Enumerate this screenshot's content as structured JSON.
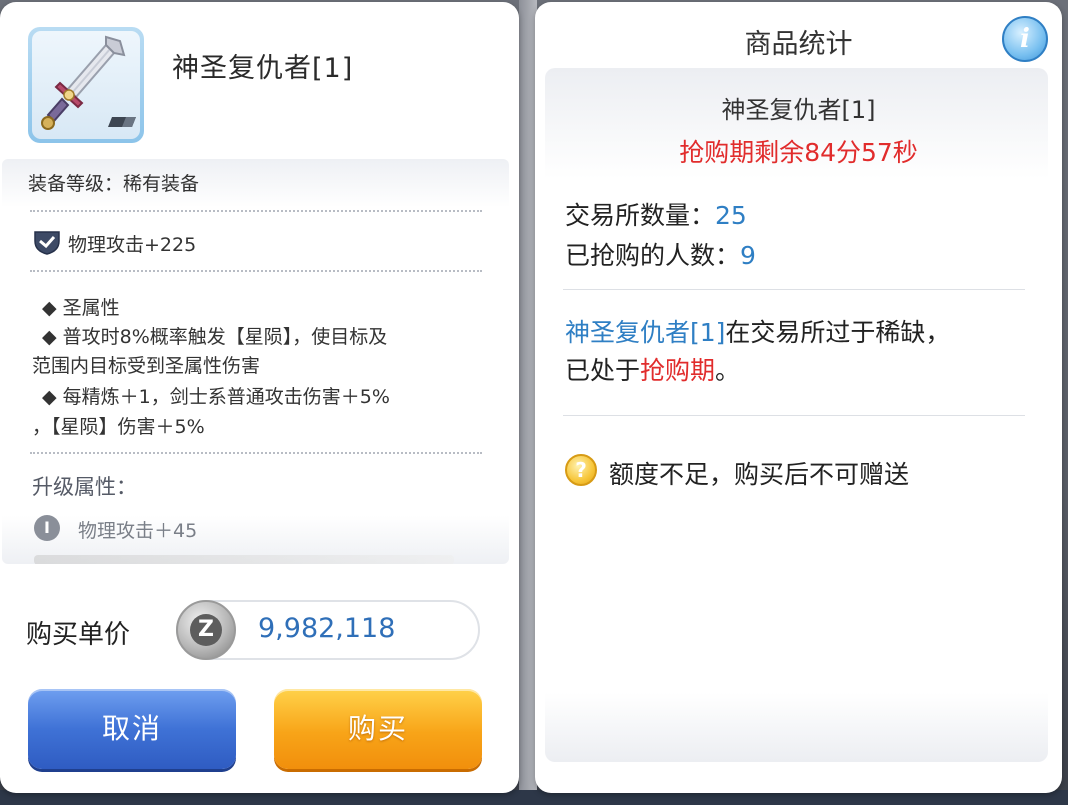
{
  "item": {
    "name": "神圣复仇者[1]"
  },
  "details": {
    "grade": "装备等级：稀有装备",
    "attack": "物理攻击+225",
    "effects": [
      "◆  圣属性",
      "◆  普攻时8%概率触发【星陨】，使目标及",
      "范围内目标受到圣属性伤害",
      "◆  每精炼＋1，剑士系普通攻击伤害＋5%",
      "，【星陨】伤害＋5%"
    ],
    "upgrade_title": "升级属性：",
    "upgrade_icon": "I",
    "upgrade_line": "物理攻击＋45"
  },
  "purchase": {
    "price_label": "购买单价",
    "currency_icon": "Z",
    "price": "9,982,118",
    "cancel_label": "取消",
    "buy_label": "购买"
  },
  "stats": {
    "title": "商品统计",
    "info_icon": "i",
    "item_name": "神圣复仇者[1]",
    "timer": "抢购期剩余84分57秒",
    "exchange_label": "交易所数量：",
    "exchange_count": "25",
    "bought_label": "已抢购的人数：",
    "bought_count": "9",
    "scarce_item": "神圣复仇者[1]",
    "scarce_mid": "在交易所过于稀缺，",
    "scarce_prefix": "已处于",
    "scarce_period": "抢购期",
    "scarce_end": "。",
    "question_icon": "?",
    "quota_text": "额度不足，购买后不可赠送"
  },
  "colors": {
    "accent_blue": "#2f7fc4",
    "alert_red": "#e12c2c",
    "cancel_button": "#3f72d6",
    "buy_button": "#f8a418"
  }
}
